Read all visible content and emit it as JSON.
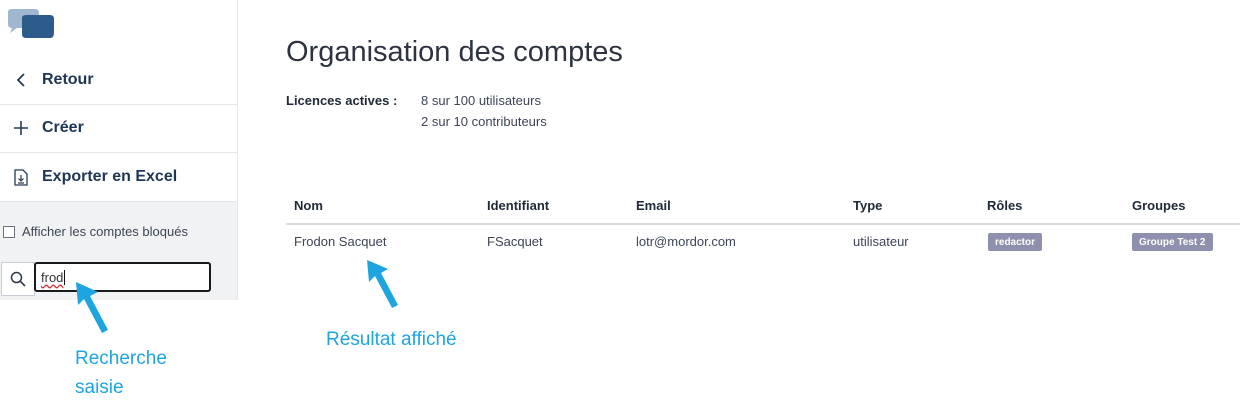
{
  "sidebar": {
    "back_label": "Retour",
    "create_label": "Créer",
    "export_label": "Exporter en Excel",
    "show_blocked_label": "Afficher les comptes bloqués",
    "search_value": "frod"
  },
  "main": {
    "title": "Organisation des comptes",
    "licenses_label": "Licences actives :",
    "licenses_users": "8 sur 100 utilisateurs",
    "licenses_contributors": "2 sur 10 contributeurs",
    "columns": [
      "Nom",
      "Identifiant",
      "Email",
      "Type",
      "Rôles",
      "Groupes"
    ],
    "rows": [
      {
        "name": "Frodon Sacquet",
        "login": "FSacquet",
        "email": "lotr@mordor.com",
        "type": "utilisateur",
        "role": "redactor",
        "group": "Groupe Test 2"
      }
    ]
  },
  "annotations": {
    "search_note_line1": "Recherche",
    "search_note_line2": "saisie",
    "result_note": "Résultat affiché"
  },
  "colors": {
    "accent": "#1ea5e0",
    "badge": "#8e91ad",
    "nav_text": "#1e3654"
  }
}
